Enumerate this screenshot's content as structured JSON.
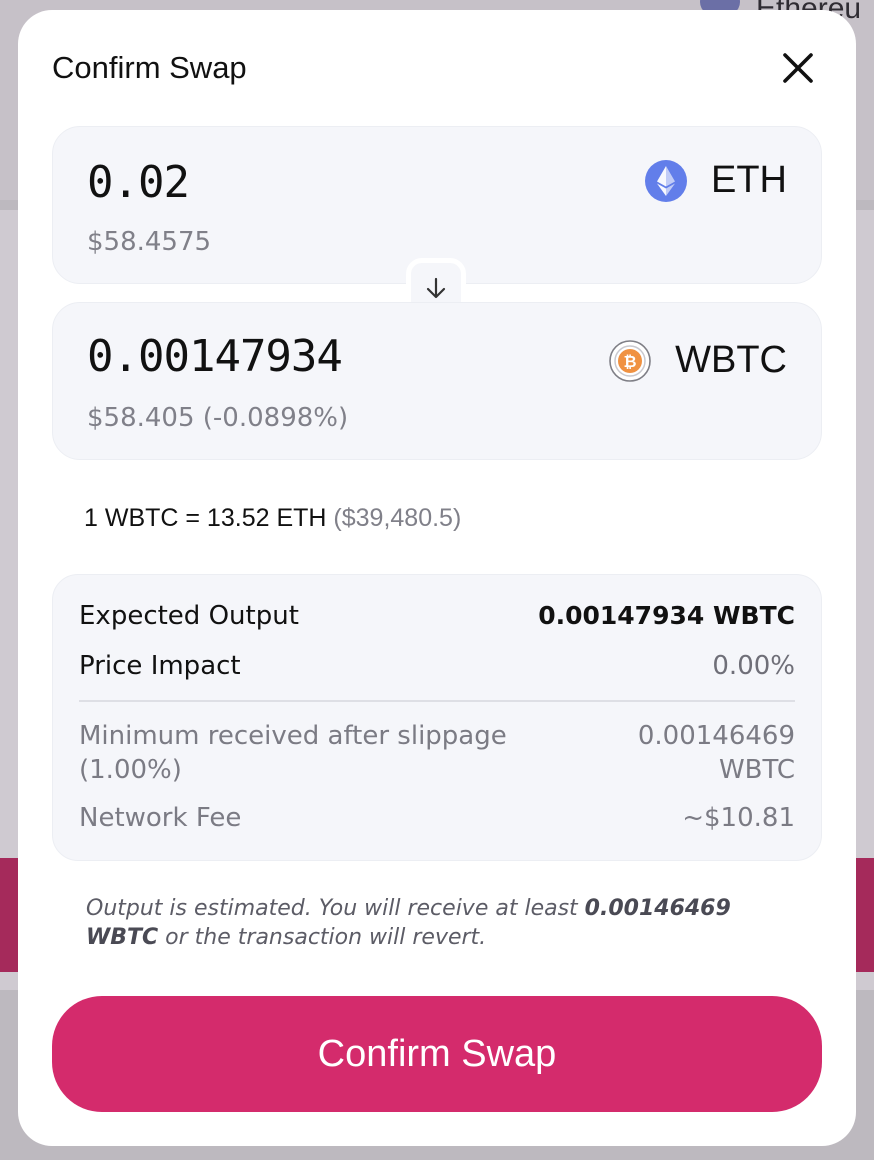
{
  "background": {
    "network_label": "Ethereu"
  },
  "modal": {
    "title": "Confirm Swap",
    "close_icon": "close-icon"
  },
  "from_token": {
    "amount": "0.02",
    "usd_value": "$58.4575",
    "symbol": "ETH",
    "icon": "eth-icon",
    "icon_color": "#627eea"
  },
  "switch_icon": "arrow-down-icon",
  "to_token": {
    "amount": "0.00147934",
    "usd_value": "$58.405 (-0.0898%)",
    "symbol": "WBTC",
    "icon": "wbtc-icon",
    "icon_color": "#f09242"
  },
  "rate": {
    "text": "1 WBTC = 13.52 ETH",
    "usd": "($39,480.5)"
  },
  "details": {
    "expected_output_label": "Expected Output",
    "expected_output_value": "0.00147934 WBTC",
    "price_impact_label": "Price Impact",
    "price_impact_value": "0.00%",
    "min_received_label": "Minimum received after slippage (1.00%)",
    "min_received_value": "0.00146469 WBTC",
    "network_fee_label": "Network Fee",
    "network_fee_value": "~$10.81"
  },
  "note": {
    "prefix": "Output is estimated. You will receive at least ",
    "amount": "0.00146469 WBTC",
    "suffix": " or the transaction will revert."
  },
  "confirm_button": {
    "label": "Confirm Swap",
    "color": "#d42b6c"
  }
}
